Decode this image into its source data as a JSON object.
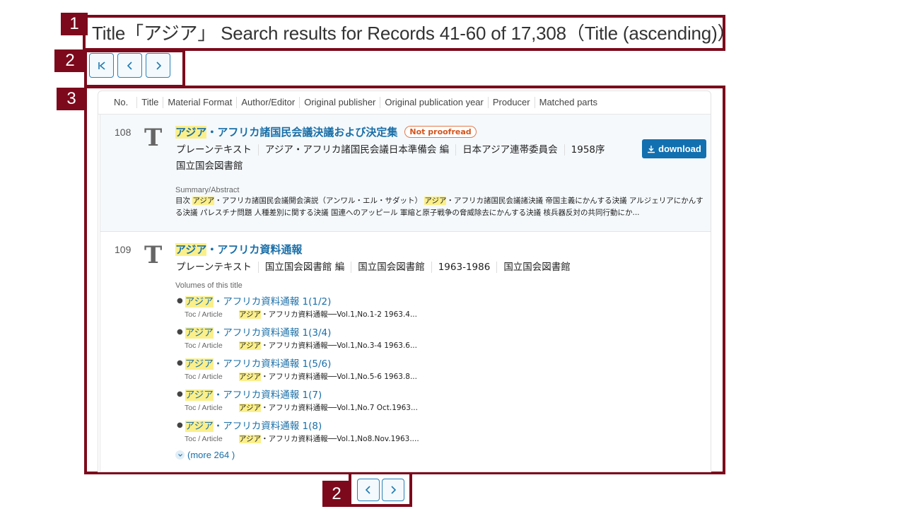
{
  "header": {
    "title": "Title「アジア」 Search results for Records 41-60 of 17,308（Title (ascending)）"
  },
  "annotations": [
    "1",
    "2",
    "3",
    "2"
  ],
  "pager_top": {
    "buttons": [
      {
        "name": "first-page",
        "icon": "first-page-icon"
      },
      {
        "name": "previous-page",
        "icon": "chevron-left-icon"
      },
      {
        "name": "next-page",
        "icon": "chevron-right-icon"
      }
    ]
  },
  "pager_bottom": {
    "buttons": [
      {
        "name": "previous-page",
        "icon": "chevron-left-icon"
      },
      {
        "name": "next-page",
        "icon": "chevron-right-icon"
      }
    ]
  },
  "columns": [
    "No.",
    "Title",
    "Material Format",
    "Author/Editor",
    "Original publisher",
    "Original publication year",
    "Producer",
    "Matched parts"
  ],
  "results": [
    {
      "no": "108",
      "type_icon": "T",
      "title_highlight": "アジア",
      "title_rest": "・アフリカ諸国民会議決議および決定集",
      "badge": "Not proofread",
      "meta": [
        "プレーンテキスト",
        "アジア・アフリカ諸国民会議日本準備会 編",
        "日本アジア連帯委員会",
        "1958序",
        "国立国会図書館"
      ],
      "download_label": "download",
      "summary_label": "Summary/Abstract",
      "abstract": {
        "part1": "目次 ",
        "hl1": "アジア",
        "part2": "・アフリカ諸国民会議開会演説（アンワル・エル・サダット） ",
        "hl2": "アジア",
        "part3": "・アフリカ諸国民会議諸決議 帝国主義にかんする決議 アルジェリアにかんする決議 パレスチナ問題 人種差別に関する決議 国連へのアッピール 軍縮と原子戦争の脅威除去にかんする決議 核兵器反対の共同行動にか..."
      }
    },
    {
      "no": "109",
      "type_icon": "T",
      "title_highlight": "アジア",
      "title_rest": "・アフリカ資料通報",
      "meta": [
        "プレーンテキスト",
        "国立国会図書館 編",
        "国立国会図書館",
        "1963-1986",
        "国立国会図書館"
      ],
      "volumes_label": "Volumes of this title",
      "volumes": [
        {
          "hl": "アジア",
          "title": "・アフリカ資料通報 1(1/2)",
          "toc_label": "Toc / Article",
          "toc_hl": "アジア",
          "toc_rest": "・アフリカ資料通報──Vol.1,No.1-2 1963.4..."
        },
        {
          "hl": "アジア",
          "title": "・アフリカ資料通報 1(3/4)",
          "toc_label": "Toc / Article",
          "toc_hl": "アジア",
          "toc_rest": "・アフリカ資料通報──Vol.1,No.3-4 1963.6..."
        },
        {
          "hl": "アジア",
          "title": "・アフリカ資料通報 1(5/6)",
          "toc_label": "Toc / Article",
          "toc_hl": "アジア",
          "toc_rest": "・アフリカ資料通報──Vol.1,No.5-6 1963.8..."
        },
        {
          "hl": "アジア",
          "title": "・アフリカ資料通報 1(7)",
          "toc_label": "Toc / Article",
          "toc_hl": "アジア",
          "toc_rest": "・アフリカ資料通報──Vol.1,No.7 Oct.1963..."
        },
        {
          "hl": "アジア",
          "title": "・アフリカ資料通報 1(8)",
          "toc_label": "Toc / Article",
          "toc_hl": "アジア",
          "toc_rest": "・アフリカ資料通報──Vol.1,No8.Nov.1963...."
        }
      ],
      "more_label": "(more 264 )"
    }
  ],
  "colors": {
    "annotation": "#7c0a1c",
    "link": "#1a6fa8",
    "highlight": "#fbef8a",
    "download": "#1270b0",
    "badge": "#d4541c"
  }
}
